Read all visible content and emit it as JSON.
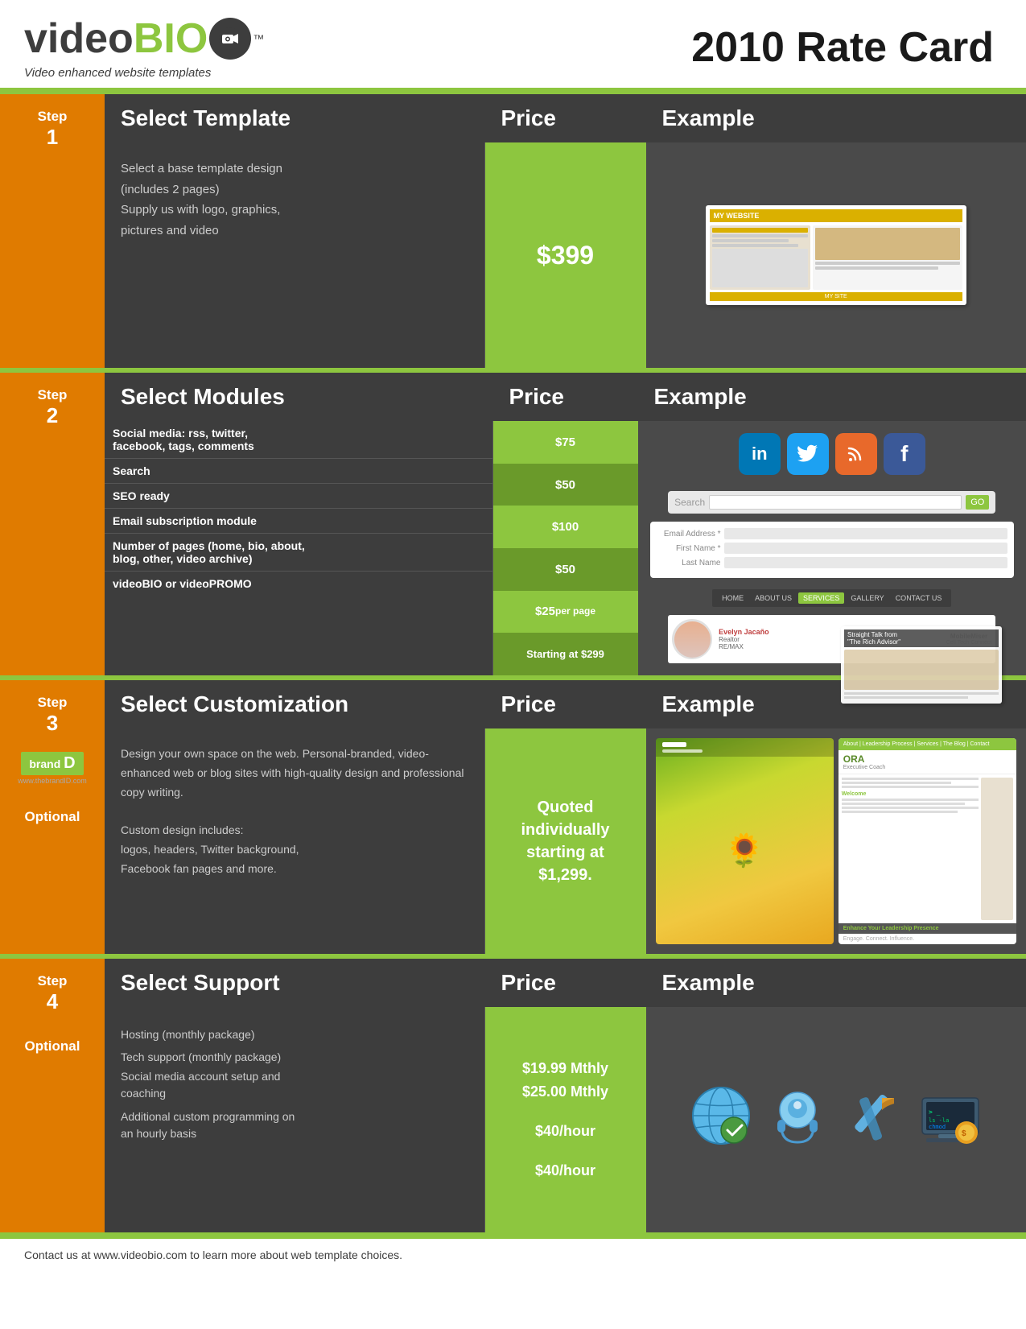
{
  "header": {
    "logo_video": "video",
    "logo_bio": "BIO",
    "logo_tm": "™",
    "logo_subtitle": "Video enhanced website templates",
    "rate_card_title": "2010 Rate Card"
  },
  "steps": [
    {
      "id": "step1",
      "label": "Step",
      "number": "1",
      "heading": "Select Template",
      "price_header": "Price",
      "example_header": "Example",
      "description": "Select a base template design (includes 2 pages)\nSupply us with logo, graphics, pictures and video",
      "price": "$399",
      "optional": false
    },
    {
      "id": "step2",
      "label": "Step",
      "number": "2",
      "heading": "Select Modules",
      "price_header": "Price",
      "example_header": "Example",
      "optional": false,
      "modules": [
        {
          "name": "Social media: rss, twitter, facebook, tags, comments",
          "price": "$75"
        },
        {
          "name": "Search",
          "price": "$50"
        },
        {
          "name": "SEO ready",
          "price": "$100"
        },
        {
          "name": "Email subscription module",
          "price": "$50"
        },
        {
          "name": "Number of pages (home, bio, about, blog, other, video archive)",
          "price": "$25\nper page"
        },
        {
          "name": "videoBIO or videoPROMO",
          "price": "Starting at $299"
        }
      ]
    },
    {
      "id": "step3",
      "label": "Step",
      "number": "3",
      "heading": "Select Customization",
      "price_header": "Price",
      "example_header": "Example",
      "optional": true,
      "brand_logo": "brand D",
      "brand_url": "www.thebrandID.com",
      "description": "Design your own space on the web. Personal-branded, video-enhanced web or blog sites with high-quality design and professional copy writing.\n\nCustom design includes: logos, headers, Twitter background, Facebook fan pages and more.",
      "price_text": "Quoted individually starting at $1,299."
    },
    {
      "id": "step4",
      "label": "Step",
      "number": "4",
      "heading": "Select Support",
      "price_header": "Price",
      "example_header": "Example",
      "optional": true,
      "items": [
        {
          "name": "Hosting (monthly package)",
          "price": "$19.99 Mthly"
        },
        {
          "name": "Tech support (monthly package)",
          "price": "$25.00 Mthly"
        },
        {
          "name": "Social media account setup and coaching",
          "price": "$40/hour"
        },
        {
          "name": "Additional custom programming on an hourly basis",
          "price": "$40/hour"
        }
      ]
    }
  ],
  "footer": {
    "text": "Contact us at www.videobio.com to learn more about web template choices."
  },
  "social_icons": [
    "in",
    "t",
    "rss",
    "f"
  ],
  "nav_items": [
    "HOME",
    "ABOUT US",
    "SERVICES",
    "GALLERY",
    "CONTACT US"
  ]
}
